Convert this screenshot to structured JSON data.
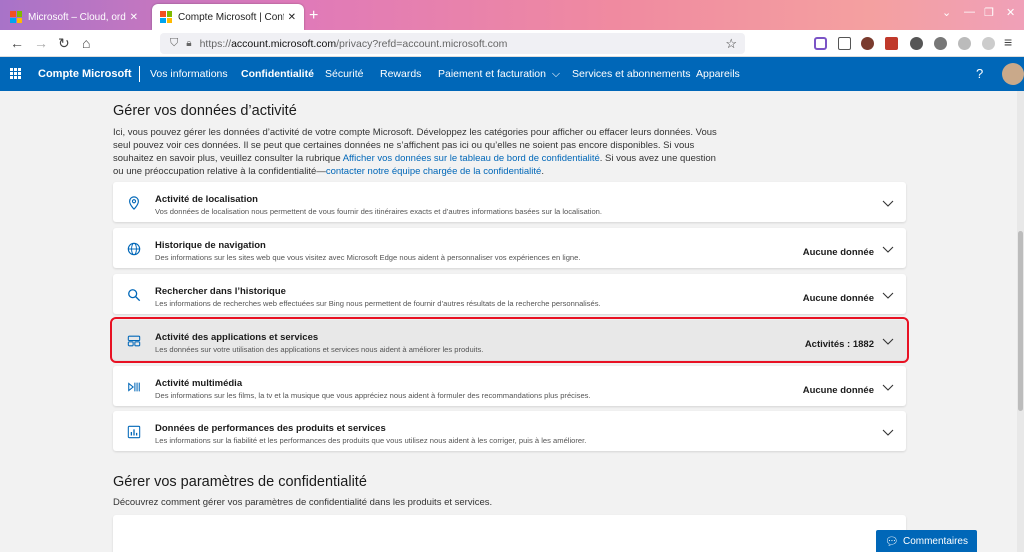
{
  "browser": {
    "tabs": [
      {
        "title": "Microsoft – Cloud, ordinateurs,"
      },
      {
        "title": "Compte Microsoft | Confidentia"
      }
    ],
    "url": {
      "scheme": "https://",
      "domain": "account.microsoft.com",
      "path": "/privacy?refd=account.microsoft.com"
    }
  },
  "header": {
    "brand": "Compte Microsoft",
    "nav": [
      "Vos informations",
      "Confidentialité",
      "Sécurité",
      "Rewards",
      "Paiement et facturation",
      "Services et abonnements",
      "Appareils"
    ],
    "help": "?"
  },
  "activity": {
    "title": "Gérer vos données d’activité",
    "desc1": "Ici, vous pouvez gérer les données d’activité de votre compte Microsoft. Développez les catégories pour afficher ou effacer leurs données. Vous",
    "desc2": "seul pouvez voir ces données. Il se peut que certaines données ne s’affichent pas ici ou qu’elles ne soient pas encore disponibles. Si vous",
    "desc3a": "souhaitez en savoir plus, veuillez consulter la rubrique ",
    "desc3link": "Afficher vos données sur le tableau de bord de confidentialité",
    "desc3b": ". Si vous avez une question",
    "desc4a": "ou une préoccupation relative à la confidentialité—",
    "desc4link": "contacter notre équipe chargée de la confidentialité",
    "desc4b": ".",
    "cards": [
      {
        "title": "Activité de localisation",
        "sub": "Vos données de localisation nous permettent de vous fournir des itinéraires exacts et d’autres informations basées sur la localisation.",
        "value": "",
        "icon": "location-pin-icon"
      },
      {
        "title": "Historique de navigation",
        "sub": "Des informations sur les sites web que vous visitez avec Microsoft Edge nous aident à personnaliser vos expériences en ligne.",
        "value": "Aucune donnée",
        "icon": "globe-icon"
      },
      {
        "title": "Rechercher dans l’historique",
        "sub": "Les informations de recherches web effectuées sur Bing nous permettent de fournir d’autres résultats de la recherche personnalisés.",
        "value": "Aucune donnée",
        "icon": "search-icon"
      },
      {
        "title": "Activité des applications et services",
        "sub": "Les données sur votre utilisation des applications et services nous aident à améliorer les produits.",
        "value": "Activités : 1882",
        "icon": "apps-icon"
      },
      {
        "title": "Activité multimédia",
        "sub": "Des informations sur les films, la tv et la musique que vous appréciez nous aident à formuler des recommandations plus précises.",
        "value": "Aucune donnée",
        "icon": "media-icon"
      },
      {
        "title": "Données de performances des produits et services",
        "sub": "Les informations sur la fiabilité et les performances des produits que vous utilisez nous aident à les corriger, puis à les améliorer.",
        "value": "",
        "icon": "chart-icon"
      }
    ]
  },
  "settings": {
    "title": "Gérer vos paramètres de confidentialité",
    "desc": "Découvrez comment gérer vos paramètres de confidentialité dans les produits et services."
  },
  "feedback": "Commentaires",
  "colors": {
    "accent": "#0067b8",
    "highlight": "#e81123"
  }
}
